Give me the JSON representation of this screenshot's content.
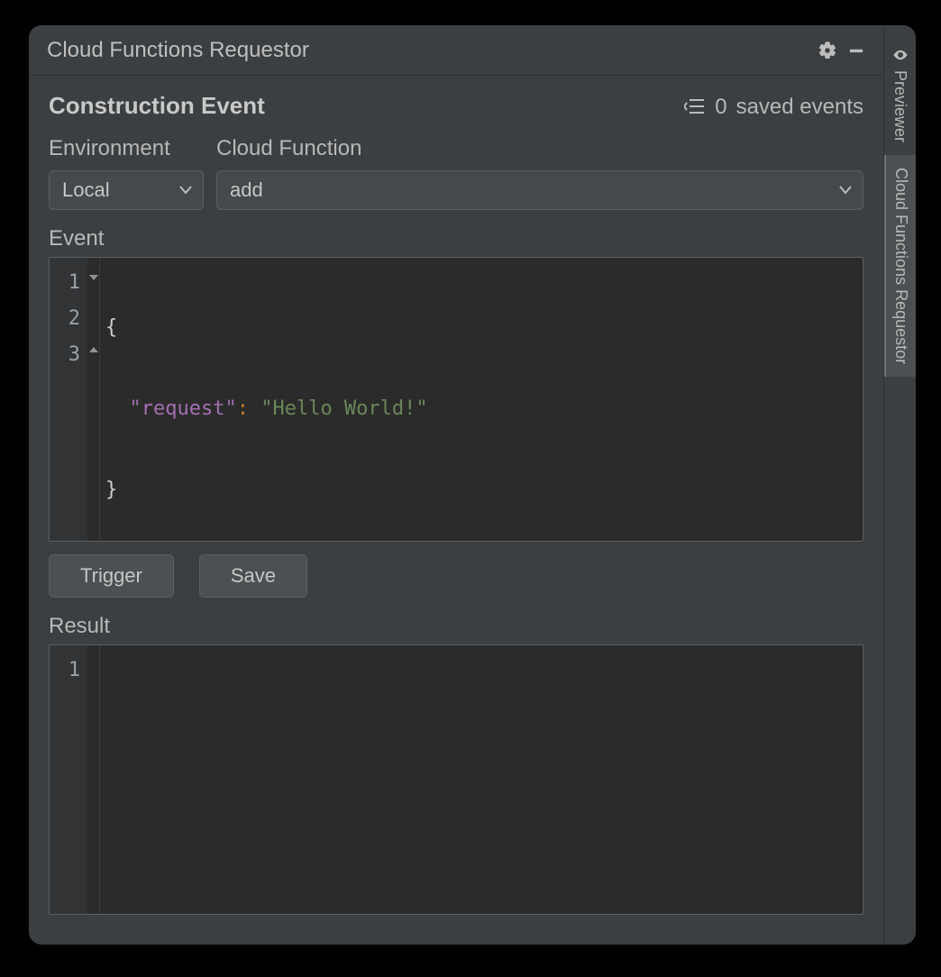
{
  "window": {
    "title": "Cloud Functions Requestor"
  },
  "header": {
    "section_title": "Construction Event",
    "saved_events_count": 0,
    "saved_events_label": "saved events"
  },
  "labels": {
    "environment": "Environment",
    "cloud_function": "Cloud Function",
    "event": "Event",
    "result": "Result"
  },
  "combos": {
    "environment_value": "Local",
    "function_value": "add"
  },
  "event_editor": {
    "lines": [
      {
        "n": 1,
        "raw": "{"
      },
      {
        "n": 2,
        "raw": "  \"request\": \"Hello World!\""
      },
      {
        "n": 3,
        "raw": "}"
      }
    ],
    "key": "\"request\"",
    "value": "\"Hello World!\""
  },
  "buttons": {
    "trigger": "Trigger",
    "save": "Save"
  },
  "result_editor": {
    "lines": [
      {
        "n": 1,
        "raw": ""
      }
    ]
  },
  "side_tabs": {
    "previewer": "Previewer",
    "requestor": "Cloud Functions Requestor"
  }
}
